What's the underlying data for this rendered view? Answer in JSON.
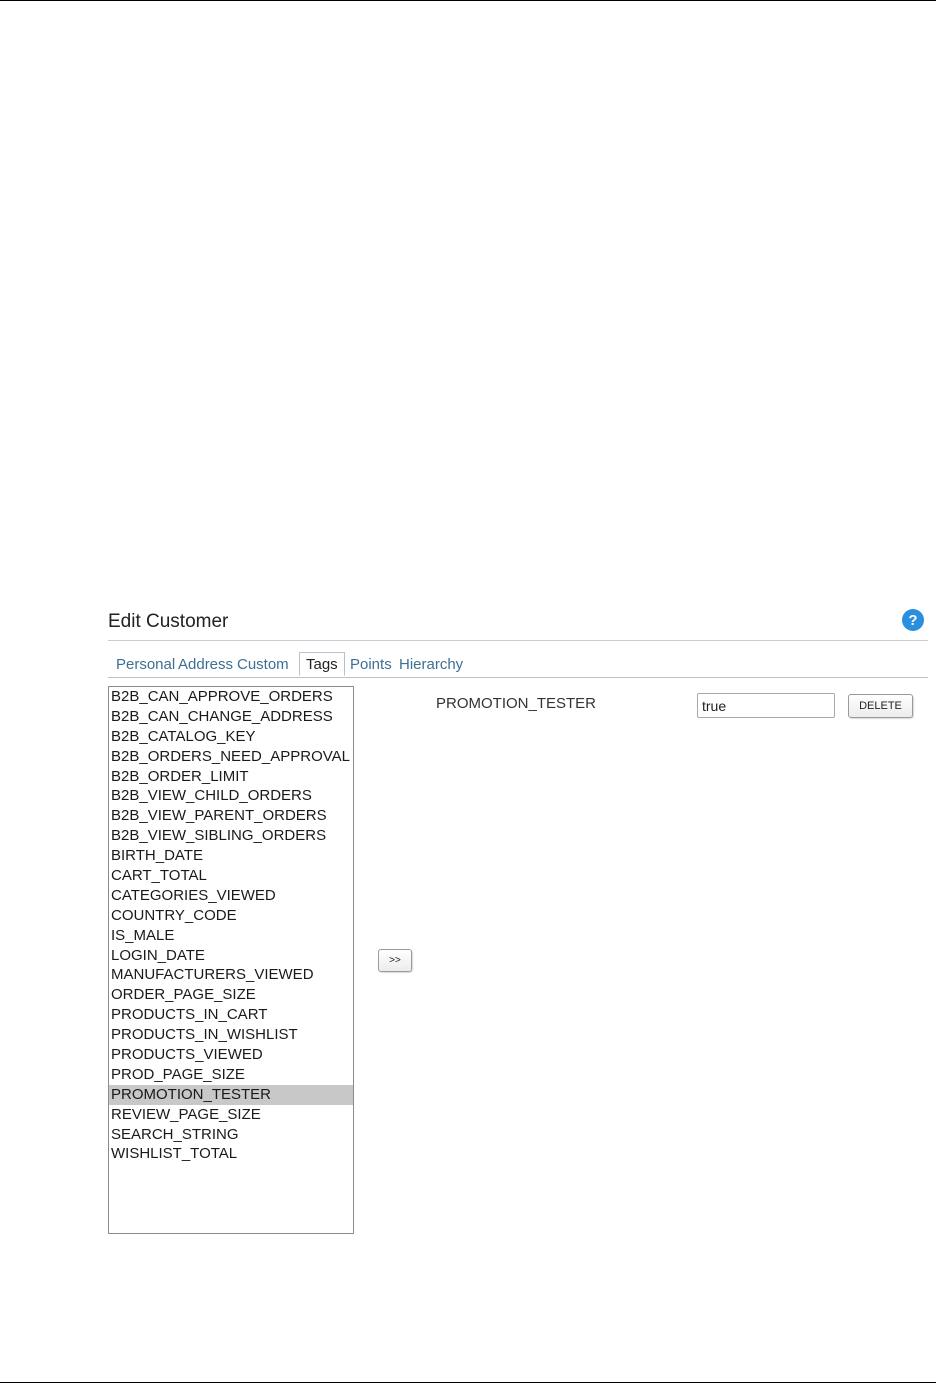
{
  "panel": {
    "title": "Edit Customer",
    "help_label": "?"
  },
  "tabs": [
    {
      "label": "Personal"
    },
    {
      "label": "Address"
    },
    {
      "label": "Custom"
    },
    {
      "label": "Tags"
    },
    {
      "label": "Points"
    },
    {
      "label": "Hierarchy"
    }
  ],
  "active_tab": "Tags",
  "tag_list": {
    "items": [
      "B2B_CAN_APPROVE_ORDERS",
      "B2B_CAN_CHANGE_ADDRESS",
      "B2B_CATALOG_KEY",
      "B2B_ORDERS_NEED_APPROVAL",
      "B2B_ORDER_LIMIT",
      "B2B_VIEW_CHILD_ORDERS",
      "B2B_VIEW_PARENT_ORDERS",
      "B2B_VIEW_SIBLING_ORDERS",
      "BIRTH_DATE",
      "CART_TOTAL",
      "CATEGORIES_VIEWED",
      "COUNTRY_CODE",
      "IS_MALE",
      "LOGIN_DATE",
      "MANUFACTURERS_VIEWED",
      "ORDER_PAGE_SIZE",
      "PRODUCTS_IN_CART",
      "PRODUCTS_IN_WISHLIST",
      "PRODUCTS_VIEWED",
      "PROD_PAGE_SIZE",
      "PROMOTION_TESTER",
      "REVIEW_PAGE_SIZE",
      "SEARCH_STRING",
      "WISHLIST_TOTAL"
    ],
    "selected": "PROMOTION_TESTER"
  },
  "move_button": {
    "label": ">>"
  },
  "assigned_tag": {
    "name": "PROMOTION_TESTER",
    "value": "true",
    "delete_label": "DELETE"
  }
}
